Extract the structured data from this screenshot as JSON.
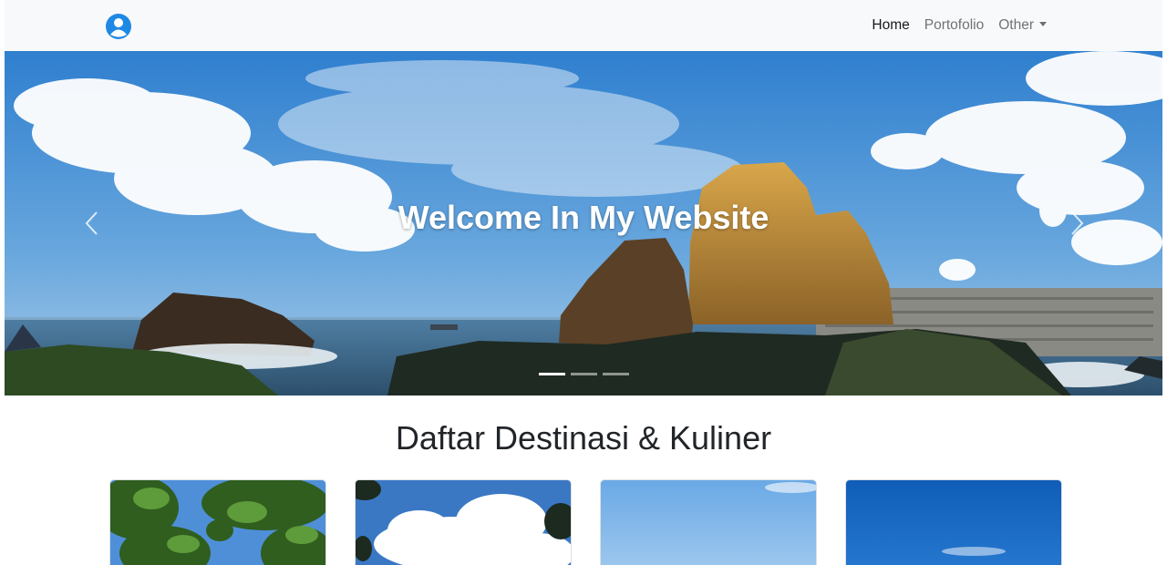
{
  "navbar": {
    "brand_icon": "user-avatar-icon",
    "links": [
      {
        "label": "Home",
        "active": true
      },
      {
        "label": "Portofolio",
        "active": false
      },
      {
        "label": "Other",
        "active": false,
        "dropdown": true
      }
    ]
  },
  "hero": {
    "caption": "Welcome In My Website",
    "prev_icon": "chevron-left-icon",
    "next_icon": "chevron-right-icon",
    "slide_count": 3,
    "active_slide": 1
  },
  "section": {
    "title": "Daftar Destinasi & Kuliner"
  },
  "colors": {
    "navbar_bg": "#f8f9fa",
    "brand_blue": "#1e88e5",
    "sky": "#3f8fd6"
  }
}
